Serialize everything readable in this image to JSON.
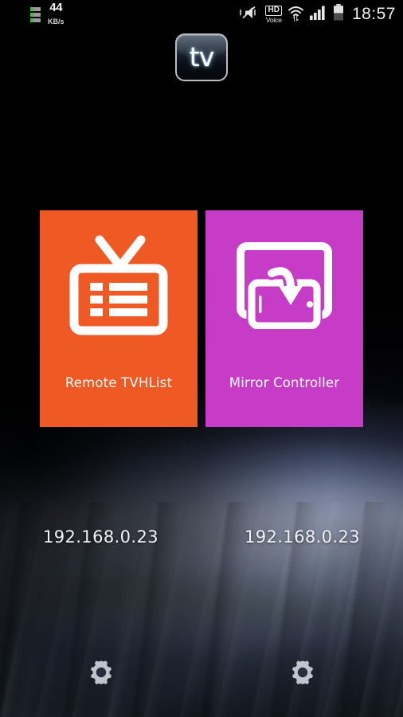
{
  "status_bar": {
    "network_speed_value": "44",
    "network_speed_unit": "KB/s",
    "hd_label": "HD",
    "voice_label": "Voice",
    "time": "18:57",
    "icons": {
      "speed": "network-speed-icon",
      "vibrate": "vibrate-mute-icon",
      "hd_voice": "hd-voice-icon",
      "wifi": "wifi-transfer-icon",
      "signal": "cellular-signal-icon",
      "battery": "battery-icon"
    }
  },
  "app": {
    "logo_text": "tv"
  },
  "tiles": [
    {
      "label": "Remote TVHList",
      "color": "#ef5a24",
      "icon": "tv-list-icon",
      "ip": "192.168.0.23",
      "settings_icon": "gear-icon"
    },
    {
      "label": "Mirror Controller",
      "color": "#c63cc6",
      "icon": "screen-mirror-icon",
      "ip": "192.168.0.23",
      "settings_icon": "gear-icon"
    }
  ],
  "theme": {
    "orange": "#ef5a24",
    "magenta": "#c63cc6",
    "text_on_tile": "#ffffff",
    "ip_text": "#f2f4f8",
    "background": "#000000"
  }
}
